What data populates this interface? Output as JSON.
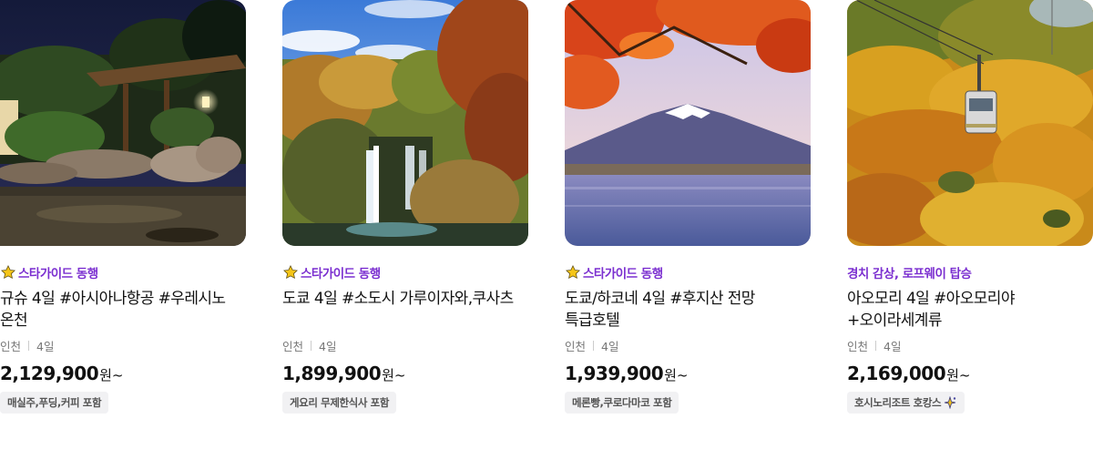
{
  "cards": [
    {
      "badge": "스타가이드 동행",
      "badge_icon": "star-icon",
      "title": "규슈 4일 #아시아나항공 #우레시노 온천",
      "origin": "인천",
      "duration": "4일",
      "price": "2,129,900",
      "price_suffix": "원~",
      "tag": "매실주,푸딩,커피 포함",
      "image": "outdoor-onsen-night"
    },
    {
      "badge": "스타가이드 동행",
      "badge_icon": "star-icon",
      "title": "도쿄 4일 #소도시 가루이자와,쿠사츠",
      "origin": "인천",
      "duration": "4일",
      "price": "1,899,900",
      "price_suffix": "원~",
      "tag": "게요리 무제한식사 포함",
      "image": "autumn-waterfall"
    },
    {
      "badge": "스타가이드 동행",
      "badge_icon": "star-icon",
      "title": "도쿄/하코네 4일 #후지산 전망 특급호텔",
      "origin": "인천",
      "duration": "4일",
      "price": "1,939,900",
      "price_suffix": "원~",
      "tag": "메론빵,쿠로다마코 포함",
      "image": "mount-fuji-maple"
    },
    {
      "badge": "경치 감상, 로프웨이 탑승",
      "badge_icon": "",
      "title": "아오모리 4일 #아오모리야+오이라세계류",
      "origin": "인천",
      "duration": "4일",
      "price": "2,169,000",
      "price_suffix": "원~",
      "tag": "호시노리조트 호캉스",
      "tag_icon": "sparkle-icon",
      "image": "ropeway-autumn-forest"
    }
  ],
  "colors": {
    "badge": "#7b2fd0",
    "star": "#f5c518",
    "tag_bg": "#f1f1f3"
  }
}
